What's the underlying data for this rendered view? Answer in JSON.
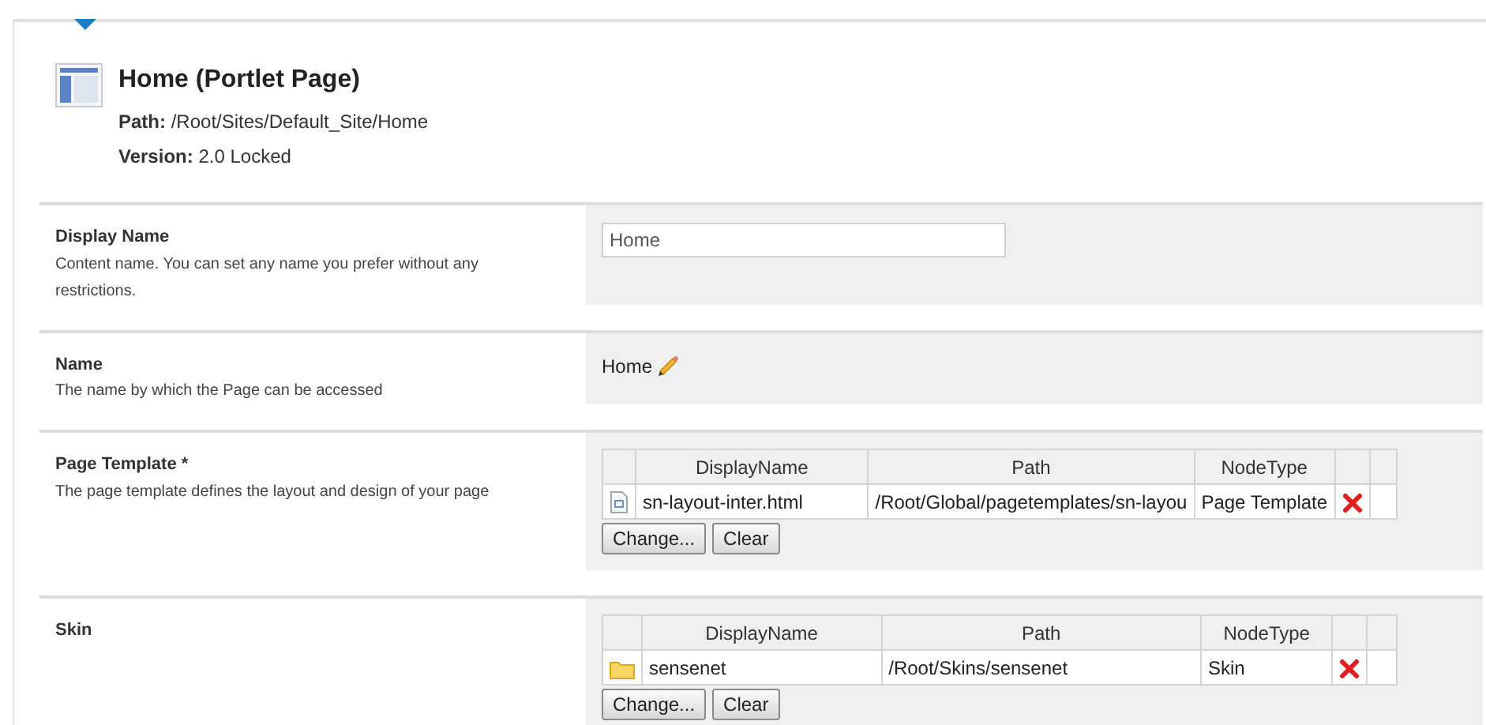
{
  "header": {
    "title": "Home (Portlet Page)",
    "path_label": "Path:",
    "path": "/Root/Sites/Default_Site/Home",
    "version_label": "Version:",
    "version": "2.0 Locked"
  },
  "fields": [
    {
      "kind": "text",
      "label": "Display Name",
      "description": "Content name. You can set any name you prefer without any restrictions.",
      "value": "Home"
    },
    {
      "kind": "readonly",
      "label": "Name",
      "description": "The name by which the Page can be accessed",
      "value": "Home"
    },
    {
      "kind": "reference",
      "label": "Page Template *",
      "description": "The page template defines the layout and design of your page",
      "columns": [
        "DisplayName",
        "Path",
        "NodeType"
      ],
      "rows": [
        {
          "kind": "file",
          "cells": [
            "sn-layout-inter.html",
            "/Root/Global/pagetemplates/sn-layou",
            "Page Template"
          ]
        }
      ],
      "buttons": [
        "Change...",
        "Clear"
      ]
    },
    {
      "kind": "reference",
      "label": "Skin",
      "columns": [
        "DisplayName",
        "Path",
        "NodeType"
      ],
      "rows": [
        {
          "kind": "folder",
          "cells": [
            "sensenet",
            "/Root/Skins/sensenet",
            "Skin"
          ]
        }
      ],
      "buttons": [
        "Change...",
        "Clear"
      ]
    }
  ]
}
